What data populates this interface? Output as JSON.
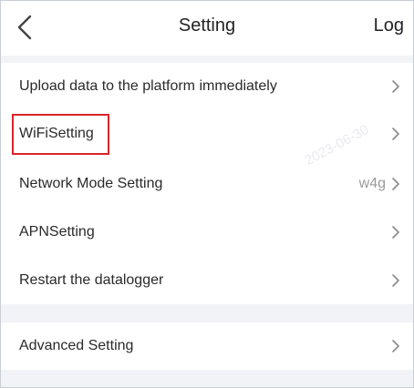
{
  "header": {
    "title": "Setting",
    "right_action": "Log",
    "back_icon": "chevron-left-icon"
  },
  "settings_group_1": [
    {
      "label": "Upload data to the platform immediately",
      "value": ""
    },
    {
      "label": "WiFiSetting",
      "value": ""
    },
    {
      "label": "Network Mode Setting",
      "value": "w4g"
    },
    {
      "label": "APNSetting",
      "value": ""
    },
    {
      "label": "Restart the datalogger",
      "value": ""
    }
  ],
  "settings_group_2": [
    {
      "label": "Advanced Setting",
      "value": ""
    }
  ],
  "watermark": {
    "date": "2023-06-30"
  },
  "colors": {
    "highlight_border": "#d9252a",
    "section_gap": "#f2f3f7",
    "chevron": "#8a8a8a"
  }
}
